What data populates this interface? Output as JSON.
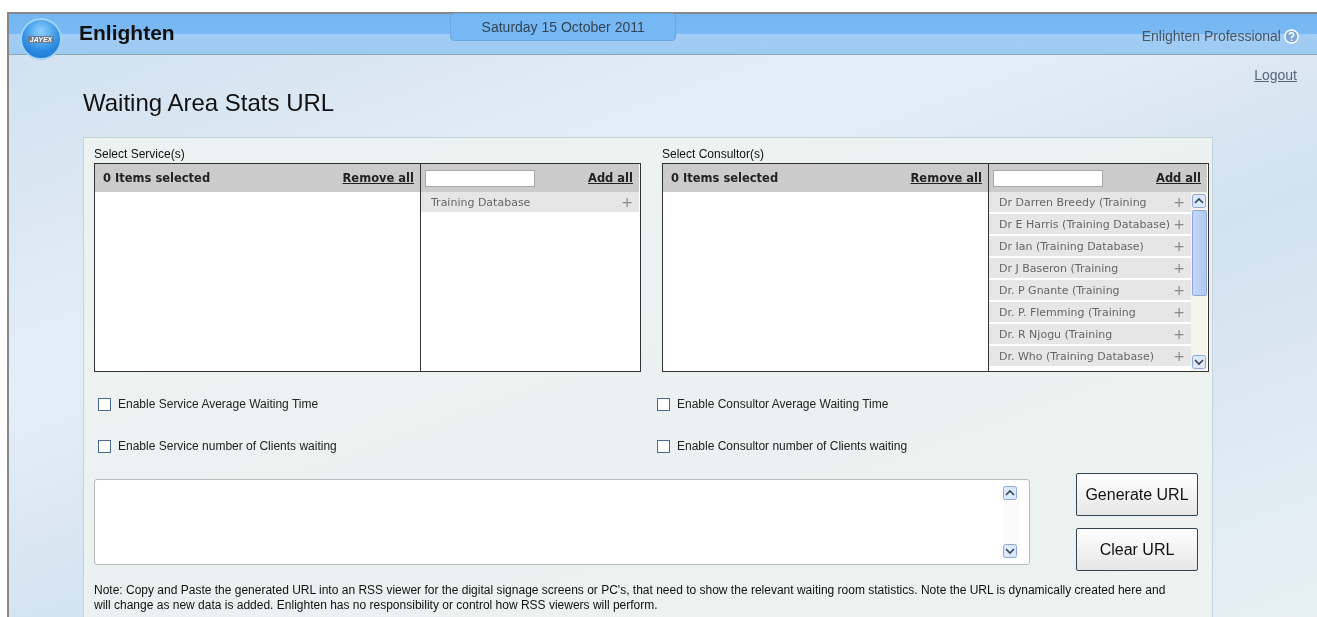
{
  "header": {
    "logo_text": "JAYEX",
    "app_name": "Enlighten",
    "date": "Saturday 15 October 2011",
    "edition": "Enlighten Professional"
  },
  "logout": "Logout",
  "title": "Waiting Area Stats URL",
  "pickers": [
    {
      "label": "Select Service(s)",
      "selected_count": "0 Items selected",
      "remove_all": "Remove all",
      "add_all": "Add all",
      "available": [
        {
          "name": "Training Database",
          "plus": "+"
        }
      ]
    },
    {
      "label": "Select Consultor(s)",
      "selected_count": "0 Items selected",
      "remove_all": "Remove all",
      "add_all": "Add all",
      "available": [
        {
          "name": "Dr Darren Breedy (Training",
          "plus": "+"
        },
        {
          "name": "Dr E Harris (Training Database)",
          "plus": "+"
        },
        {
          "name": "Dr Ian (Training Database)",
          "plus": "+"
        },
        {
          "name": "Dr J Baseron (Training",
          "plus": "+"
        },
        {
          "name": "Dr. P Gnante (Training",
          "plus": "+"
        },
        {
          "name": "Dr. P. Flemming (Training",
          "plus": "+"
        },
        {
          "name": "Dr. R Njogu (Training",
          "plus": "+"
        },
        {
          "name": "Dr. Who (Training Database)",
          "plus": "+"
        }
      ]
    }
  ],
  "options": [
    [
      {
        "label": "Enable Service Average Waiting Time",
        "checked": false
      },
      {
        "label": "Enable Service number of Clients waiting",
        "checked": false
      }
    ],
    [
      {
        "label": "Enable Consultor Average Waiting Time",
        "checked": false
      },
      {
        "label": "Enable Consultor number of Clients waiting",
        "checked": false
      }
    ]
  ],
  "buttons": [
    "Generate URL",
    "Clear URL"
  ],
  "note": "Note: Copy and Paste the generated URL into an RSS viewer for the digital signage screens or PC's, that need to show the relevant waiting room statistics. Note the URL is dynamically created here and will change as new data is added. Enlighten has no responsibility or control how RSS viewers will perform."
}
